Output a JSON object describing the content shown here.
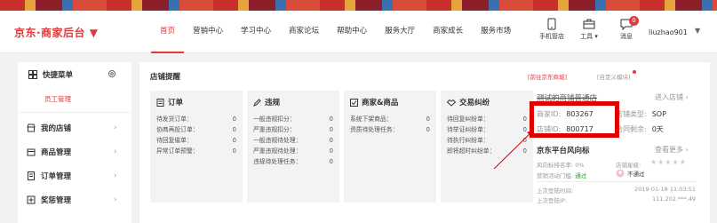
{
  "header": {
    "logo": "京东·商家后台 ▼",
    "nav": [
      "首页",
      "营销中心",
      "学习中心",
      "商家论坛",
      "帮助中心",
      "服务大厅",
      "商家成长",
      "服务市场"
    ],
    "tools": [
      {
        "label": "手机管店",
        "icon": "mobile-icon"
      },
      {
        "label": "工具 ▾",
        "icon": "toolbox-icon"
      },
      {
        "label": "消息",
        "icon": "message-icon",
        "badge": "0"
      }
    ],
    "username": "liuzhao901",
    "user_caret": "▼"
  },
  "sidebar": {
    "quick_menu": "快捷菜单",
    "staff_link": "员工管理",
    "menus": [
      "我的店铺",
      "商品管理",
      "订单管理",
      "奖惩管理"
    ],
    "arrow": "›"
  },
  "main": {
    "title": "店铺提醒",
    "cards": [
      {
        "title": "订单",
        "icon": "document-icon",
        "rows": [
          [
            "待发货订单：",
            "0"
          ],
          [
            "协商再投订单：",
            "0"
          ],
          [
            "待回复催单：",
            "0"
          ],
          [
            "异常订单预警：",
            "0"
          ]
        ]
      },
      {
        "title": "违规",
        "icon": "pencil-icon",
        "rows": [
          [
            "一般违规扣分：",
            "0"
          ],
          [
            "严重违规扣分：",
            "0"
          ],
          [
            "一般违规待处理：",
            "0"
          ],
          [
            "严重违规待处理：",
            "0"
          ],
          [
            "违规待处理任务：",
            "0"
          ]
        ]
      },
      {
        "title": "商家&商品",
        "icon": "store-icon",
        "rows": [
          [
            "系统下架商品：",
            "0"
          ],
          [
            "资质待处理任务：",
            "0"
          ]
        ]
      },
      {
        "title": "交易纠纷",
        "icon": "handshake-icon",
        "rows": [
          [
            "待回复纠纷单：",
            "0"
          ],
          [
            "待举证纠纷单：",
            "0"
          ],
          [
            "待执行纠纷单：",
            "0"
          ],
          [
            "即将超时纠纷单：",
            "0"
          ]
        ]
      }
    ]
  },
  "right": {
    "links": [
      "[前往京东商城]",
      "[自定义模块]"
    ],
    "shop_name": "测试的商铺普通店",
    "enter_shop": "进入店铺 ›",
    "merchant_id_label": "商家ID:",
    "merchant_id": "803267",
    "shop_type_label": "店铺类型:",
    "shop_type": "SOP",
    "shop_id_label": "店铺ID:",
    "shop_id": "800717",
    "contract_label": "合同剩余:",
    "contract": "0天",
    "risk_title": "京东平台风向标",
    "risk_more": "查看更多 ›",
    "risk_score_label": "风向标排名率:",
    "risk_score": "0%",
    "shop_star_label": "店铺星级:",
    "stars": "★★★★★",
    "marketing_label": "营销活动门槛:",
    "marketing_value": "通过",
    "result_value": "不通过",
    "last_login_time_label": "上次登陆时间:",
    "last_login_time": "2019-01-18 11:03:51",
    "last_login_ip_label": "上次登陆IP:",
    "last_login_ip": "111.202.***.49"
  }
}
